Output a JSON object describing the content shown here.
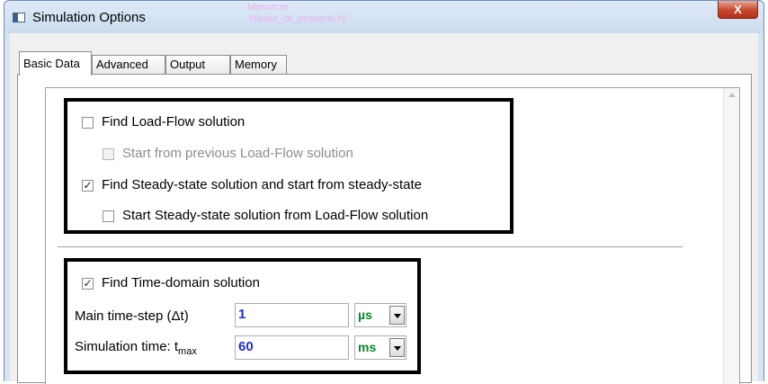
{
  "window": {
    "title": "Simulation Options",
    "close_glyph": "X",
    "ghost_text": [
      "Mesurcer",
      "Hleeur_dr_psspertv.hi"
    ]
  },
  "tabs": [
    {
      "label": "Basic Data",
      "active": true
    },
    {
      "label": "Advanced",
      "active": false
    },
    {
      "label": "Output",
      "active": false
    },
    {
      "label": "Memory",
      "active": false
    }
  ],
  "group1": {
    "load_flow": {
      "label": "Find Load-Flow solution",
      "checked": false,
      "enabled": true
    },
    "start_prev_lf": {
      "label": "Start from previous Load-Flow solution",
      "checked": false,
      "enabled": false
    },
    "steady_state": {
      "label": "Find Steady-state solution and start from steady-state",
      "checked": true,
      "enabled": true
    },
    "ss_from_lf": {
      "label": "Start Steady-state solution from Load-Flow solution",
      "checked": false,
      "enabled": true
    }
  },
  "group2": {
    "time_domain": {
      "label": "Find Time-domain solution",
      "checked": true,
      "enabled": true
    },
    "time_step": {
      "label": "Main time-step (Δt)",
      "value": "1",
      "unit": "µs"
    },
    "sim_time": {
      "label_main": "Simulation time: t",
      "label_sub": "max",
      "value": "60",
      "unit": "ms"
    }
  },
  "check_glyph": "✓",
  "colors": {
    "input_value": "#1f2fd0",
    "unit_value": "#0a8a2b",
    "close_button": "#c7452b"
  }
}
